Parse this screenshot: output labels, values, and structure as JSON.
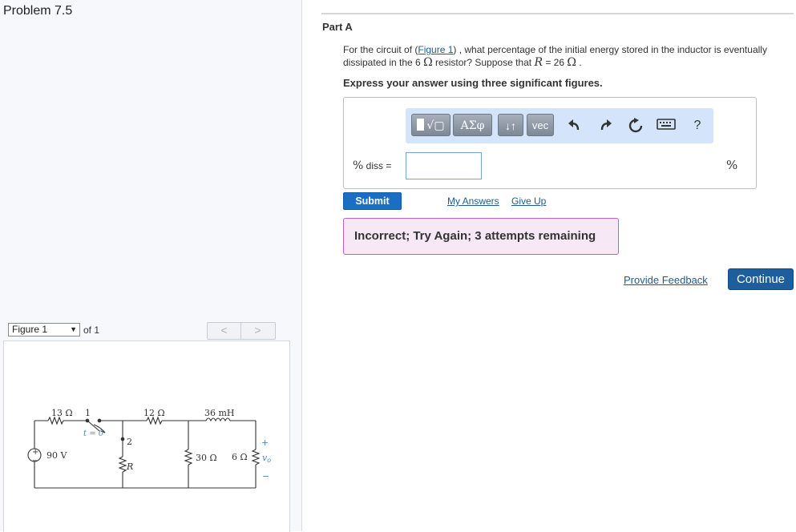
{
  "left": {
    "problem_title": "Problem 7.5",
    "figure_select": "Figure 1",
    "figure_of": "of 1",
    "nav_prev": "<",
    "nav_next": ">"
  },
  "figure": {
    "r1": "13 Ω",
    "switch_pos1": "1",
    "switch_time": "t = 0",
    "switch_pos2": "2",
    "r2": "12 Ω",
    "inductor": "36 mH",
    "source_plus": "+",
    "source_minus": "−",
    "source": "90 V",
    "r_var": "R",
    "r3": "30 Ω",
    "r4": "6 Ω",
    "vo": "v",
    "vo_sub": "o",
    "vo_plus": "+",
    "vo_minus": "−"
  },
  "part": {
    "title": "Part A",
    "question_pre": "For the circuit of (",
    "figure_link": "Figure 1",
    "question_mid1": ") , what percentage of the initial energy stored in the inductor is eventually dissipated in the 6 ",
    "omega1": "Ω",
    "question_mid2": " resistor? Suppose that ",
    "r_symbol": "R",
    "question_eq": " = 26 ",
    "omega2": "Ω",
    "question_end": " .",
    "instruction": "Express your answer using three significant figures."
  },
  "toolbar": {
    "templates": "√▢",
    "greek": "ΑΣφ",
    "arrows": "↓↑",
    "vec": "vec",
    "undo_icon": "undo-icon",
    "redo_icon": "redo-icon",
    "reset_icon": "reset-icon",
    "keyboard_icon": "keyboard-icon",
    "help": "?"
  },
  "answer": {
    "label_symbol": "%",
    "label_text": " diss =",
    "value": "",
    "unit": "%"
  },
  "actions": {
    "submit": "Submit",
    "my_answers": "My Answers",
    "give_up": "Give Up",
    "feedback": "Incorrect; Try Again; 3 attempts remaining",
    "provide_feedback": "Provide Feedback",
    "continue": "Continue"
  },
  "colors": {
    "submit_bg": "#1a6fc4",
    "continue_bg": "#1d5f9c",
    "feedback_bg": "#f7e8f5",
    "feedback_border": "#c55fbd",
    "toolbar_bg": "#d4e5fb",
    "link": "#1f5b8f"
  }
}
